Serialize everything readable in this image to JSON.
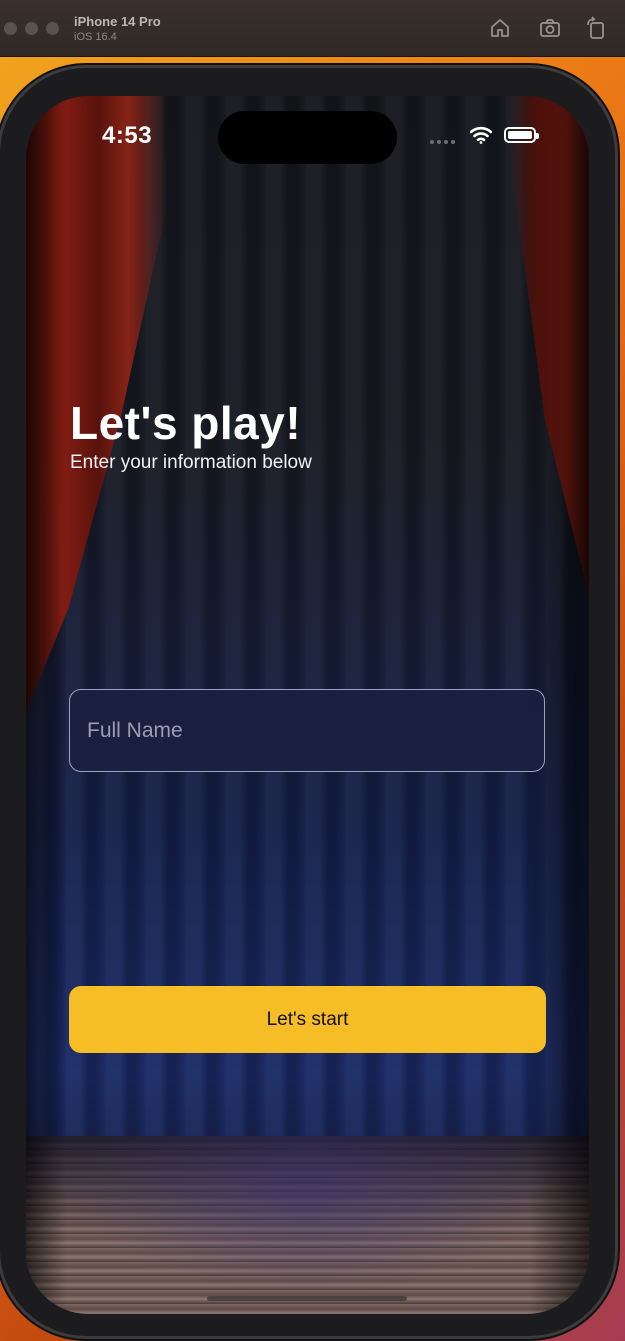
{
  "simulator": {
    "device_name": "iPhone 14 Pro",
    "os_version": "iOS 16.4",
    "toolbar_icons": [
      "home-icon",
      "screenshot-icon",
      "rotate-icon"
    ]
  },
  "status_bar": {
    "time": "4:53",
    "icons": [
      "cellular-signal-icon",
      "wifi-icon",
      "battery-icon"
    ],
    "battery_level": 1.0
  },
  "main": {
    "title": "Let's play!",
    "subtitle": "Enter your information below",
    "name_input": {
      "placeholder": "Full Name",
      "value": ""
    },
    "start_button_label": "Let's start"
  },
  "colors": {
    "accent_button": "#F6BD27",
    "input_background": "#1B1F40",
    "input_border": "#9EA2BD",
    "text_primary": "#FFFFFF"
  }
}
